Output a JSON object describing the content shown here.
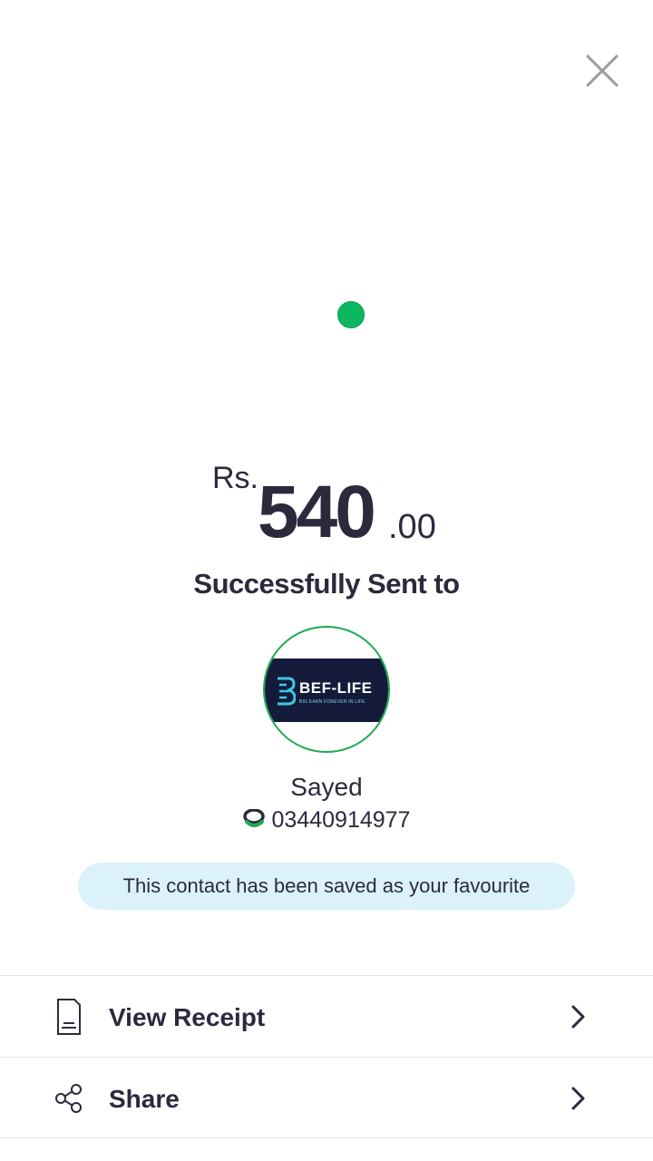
{
  "header": {
    "close_icon": "close-icon"
  },
  "status": {
    "indicator_color": "#0bb860"
  },
  "amount": {
    "currency": "Rs.",
    "whole": "540",
    "decimal": ".00"
  },
  "confirmation": {
    "message": "Successfully Sent to"
  },
  "recipient": {
    "avatar_brand": "BEF-LIFE",
    "avatar_tagline": "BIG EARN FOREVER IN LIFE",
    "name": "Sayed",
    "account_icon": "easypaisa-icon",
    "phone": "03440914977"
  },
  "favourite_notice": "This contact has been saved as your favourite",
  "menu": [
    {
      "icon": "receipt-icon",
      "label": "View Receipt"
    },
    {
      "icon": "share-icon",
      "label": "Share"
    }
  ],
  "colors": {
    "accent": "#1eaa55",
    "text": "#2b2a3d",
    "banner_bg": "#dcf2fb"
  }
}
